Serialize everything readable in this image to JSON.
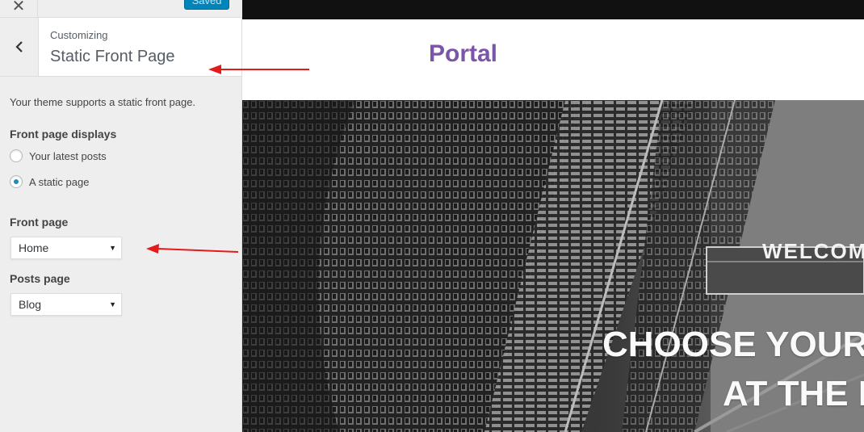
{
  "sidebar": {
    "close_icon": "close-icon",
    "saved_label": "Saved",
    "back_icon": "chevron-left-icon",
    "customizing_label": "Customizing",
    "section_title": "Static Front Page",
    "description": "Your theme supports a static front page.",
    "front_page_displays": {
      "label": "Front page displays",
      "options": [
        {
          "label": "Your latest posts",
          "checked": false
        },
        {
          "label": "A static page",
          "checked": true
        }
      ]
    },
    "front_page": {
      "label": "Front page",
      "value": "Home"
    },
    "posts_page": {
      "label": "Posts page",
      "value": "Blog"
    }
  },
  "preview": {
    "site_title": "Portal",
    "hero_welcome": "WELCOM",
    "hero_line1": "CHOOSE YOUR",
    "hero_line2": "AT THE F"
  },
  "colors": {
    "accent": "#0085ba",
    "site_title": "#7b55a8",
    "annotation_arrow": "#e31b1b",
    "radio_checked": "#1e8cbe"
  }
}
